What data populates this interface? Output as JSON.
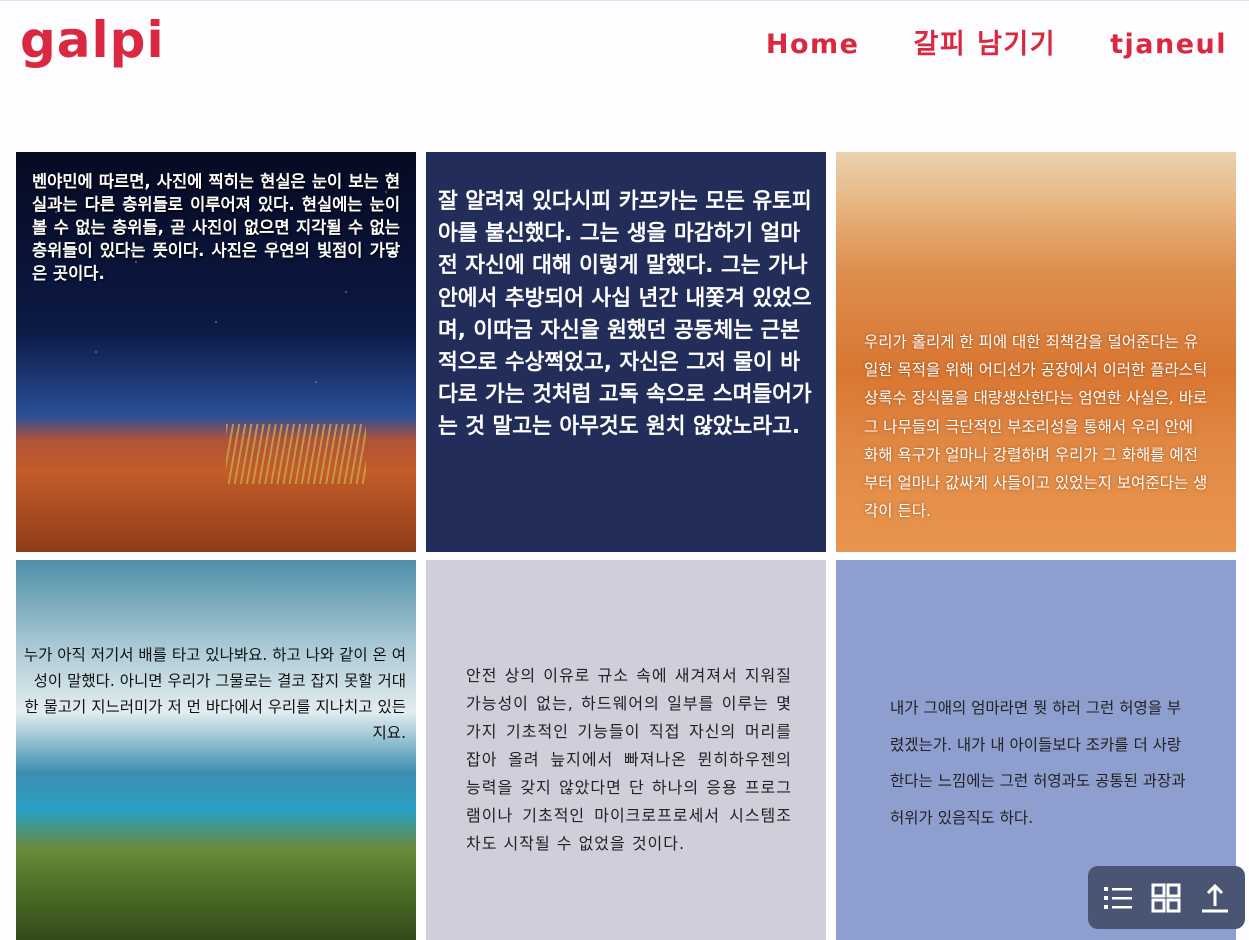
{
  "header": {
    "logo": "galpi",
    "nav": [
      "Home",
      "갈피 남기기",
      "tjaneul"
    ]
  },
  "cards": [
    {
      "text": "벤야민에 따르면, 사진에 찍히는 현실은 눈이 보는 현실과는 다른 층위들로 이루어져 있다. 현실에는 눈이 볼 수 없는 층위들, 곧 사진이 없으면 지각될 수 없는 층위들이 있다는 뜻이다. 사진은 우연의 빛점이 가닿은 곳이다."
    },
    {
      "text": "잘 알려져 있다시피 카프카는 모든 유토피아를 불신했다. 그는 생을 마감하기 얼마 전 자신에 대해 이렇게 말했다. 그는 가나안에서 추방되어 사십 년간 내쫓겨 있었으며, 이따금 자신을 원했던 공동체는 근본적으로 수상쩍었고, 자신은 그저 물이 바다로 가는 것처럼 고독 속으로 스며들어가는 것 말고는 아무것도 원치 않았노라고."
    },
    {
      "text": "우리가 홀리게 한 피에 대한 죄책감을 덜어준다는 유일한 목적을 위해 어디선가 공장에서 이러한 플라스틱 상록수 장식물을 대량생산한다는 엄연한 사실은, 바로 그 나무들의 극단적인 부조리성을 통해서 우리 안에 화해 욕구가 얼마나 강렬하며 우리가 그 화해를 예전부터 얼마나 값싸게 사들이고 있었는지 보여준다는 생각이 든다."
    },
    {
      "text": "누가 아직 저기서 배를 타고 있나봐요. 하고 나와 같이 온 여성이 말했다. 아니면 우리가 그물로는 결코 잡지 못할 거대한 물고기 지느러미가 저 먼 바다에서 우리를 지나치고 있든지요."
    },
    {
      "text": "안전 상의 이유로 규소 속에 새겨져서 지워질 가능성이 없는, 하드웨어의 일부를 이루는 몇 가지 기초적인 기능들이 직접 자신의 머리를 잡아 올려 늪지에서 빠져나온 뮌히하우젠의 능력을 갖지 않았다면 단 하나의 응용 프로그램이나 기초적인 마이크로프로세서 시스템조차도 시작될 수 없었을 것이다."
    },
    {
      "text": "내가 그애의 엄마라면 뭣 하러 그런 허영을 부렸겠는가. 내가 내 아이들보다 조카를 더 사랑한다는 느낌에는 그런 허영과도 공통된 과장과 허위가 있음직도 하다."
    }
  ],
  "toolbar": {
    "icons": [
      "list-icon",
      "grid-icon",
      "upload-icon"
    ]
  },
  "colors": {
    "brand": "#d9283f",
    "toolbar": "#4a5574"
  }
}
